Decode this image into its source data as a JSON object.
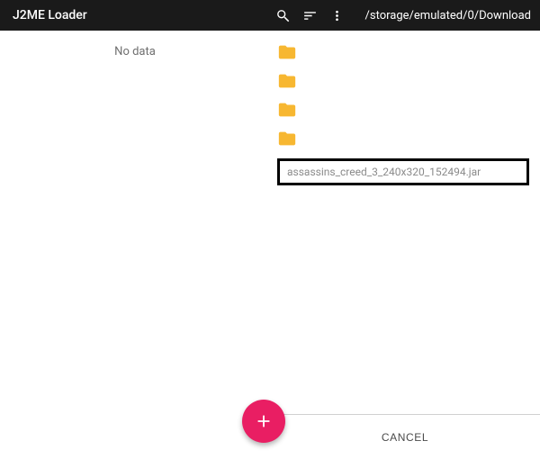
{
  "toolbar": {
    "title": "J2ME Loader",
    "path": "/storage/emulated/0/Download"
  },
  "left": {
    "empty_text": "No data"
  },
  "right": {
    "folders": [
      "",
      "",
      "",
      ""
    ],
    "file_name": "assassins_creed_3_240x320_152494.jar"
  },
  "actions": {
    "cancel": "CANCEL"
  },
  "colors": {
    "toolbar_bg": "#1a1a1a",
    "folder": "#f7b731",
    "fab": "#e91e63"
  }
}
